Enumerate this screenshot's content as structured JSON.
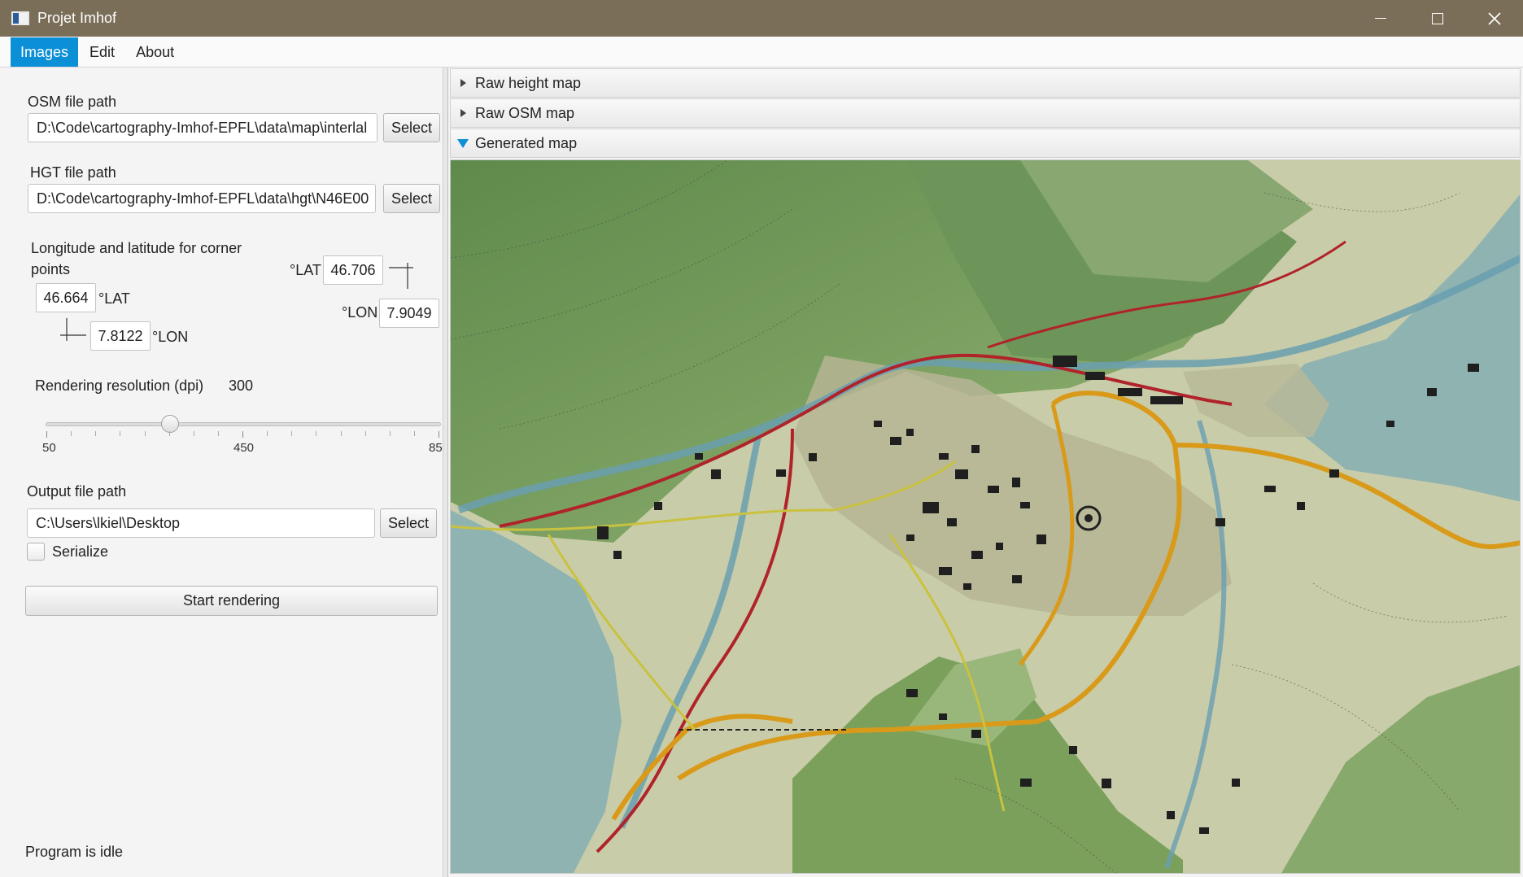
{
  "window": {
    "title": "Projet Imhof"
  },
  "menu": {
    "items": [
      "Images",
      "Edit",
      "About"
    ]
  },
  "form": {
    "osm_label": "OSM file path",
    "osm_value": "D:\\Code\\cartography-Imhof-EPFL\\data\\map\\interlal",
    "hgt_label": "HGT file path",
    "hgt_value": "D:\\Code\\cartography-Imhof-EPFL\\data\\hgt\\N46E00",
    "select_label": "Select",
    "corner_label": "Longitude and latitude for corner points",
    "bottom_left": {
      "lat": "46.664",
      "lon": "7.8122"
    },
    "top_right": {
      "lat": "46.706",
      "lon": "7.9049"
    },
    "lat_unit": "°LAT",
    "lon_unit": "°LON",
    "resolution_label": "Rendering resolution (dpi)",
    "resolution_value": "300",
    "slider": {
      "min_label": "50",
      "mid_label": "450",
      "max_label": "85",
      "value": 300,
      "min": 50,
      "max": 850
    },
    "output_label": "Output file path",
    "output_value": "C:\\Users\\lkiel\\Desktop",
    "serialize_label": "Serialize",
    "serialize_checked": false,
    "start_label": "Start rendering",
    "status": "Program is idle"
  },
  "accordion": {
    "panes": [
      {
        "label": "Raw height map",
        "expanded": false
      },
      {
        "label": "Raw OSM map",
        "expanded": false
      },
      {
        "label": "Generated map",
        "expanded": true
      }
    ]
  },
  "colors": {
    "titlebar": "#7b6e59",
    "accent": "#0b8fd6",
    "water": "#8fb7b8",
    "terrain": "#c8cca7",
    "forest": "#7ea35f",
    "motorway": "#d99a1a",
    "railway": "#b0232a"
  }
}
